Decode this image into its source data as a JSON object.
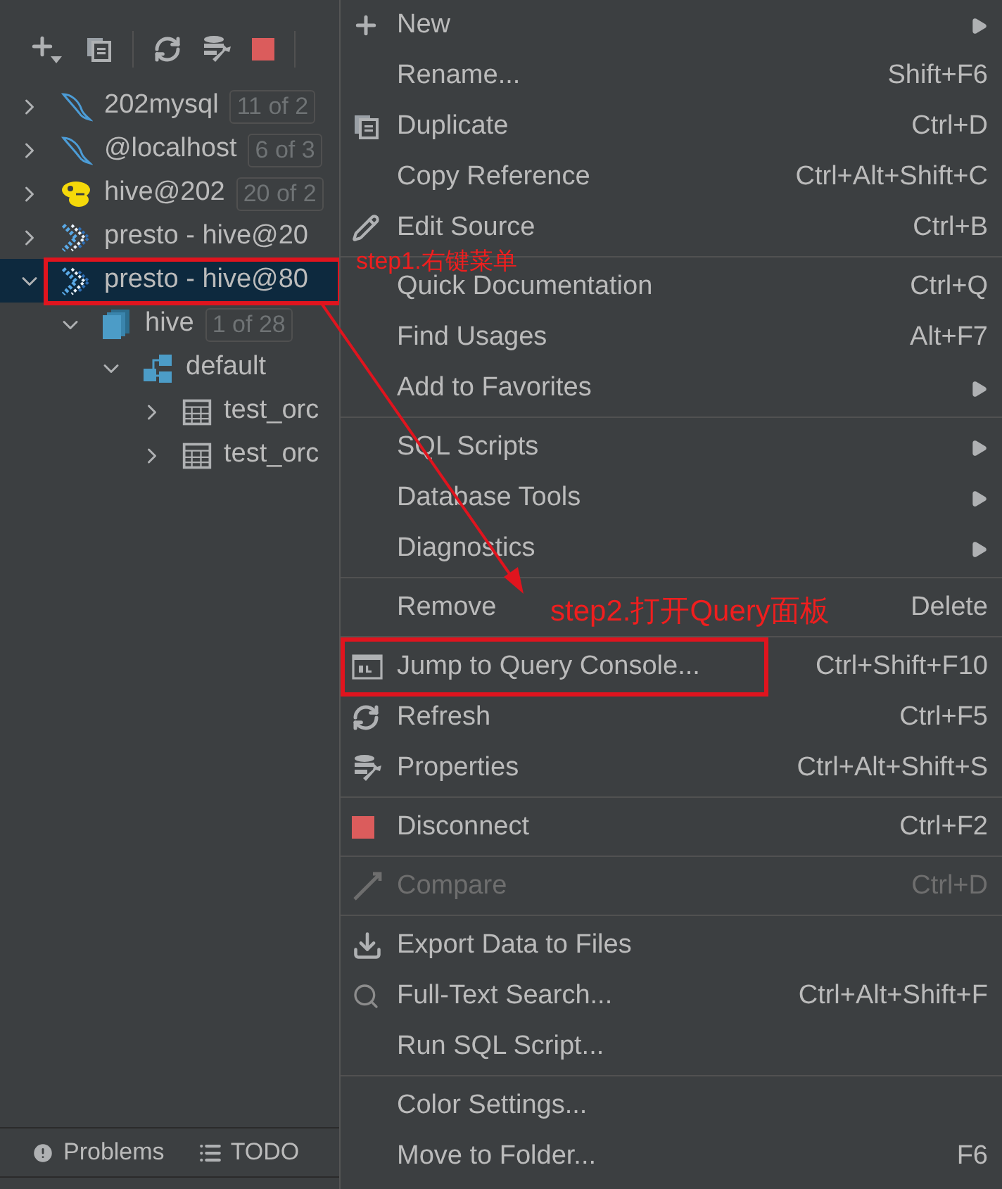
{
  "toolbar": [
    {
      "kind": "add"
    },
    {
      "kind": "duplicate"
    },
    {
      "kind": "refresh"
    },
    {
      "kind": "properties"
    },
    {
      "kind": "stop"
    }
  ],
  "tree": [
    {
      "label": "202mysql",
      "kind": "mysql",
      "badge": "11 of 2",
      "expanded": false,
      "selected": false
    },
    {
      "label": "@localhost",
      "kind": "mysql",
      "badge": "6 of 3",
      "expanded": false,
      "selected": false
    },
    {
      "label": "hive@202",
      "kind": "hive",
      "badge": "20 of 2",
      "expanded": false,
      "selected": false
    },
    {
      "label": "presto - hive@20",
      "kind": "presto",
      "expanded": false,
      "selected": false
    },
    {
      "label": "presto - hive@80",
      "kind": "presto",
      "expanded": true,
      "selected": true,
      "annotated": true,
      "children": [
        {
          "label": "hive",
          "kind": "database",
          "badge": "1 of 28",
          "expanded": true,
          "selected": false,
          "children": [
            {
              "label": "default",
              "kind": "schema",
              "expanded": true,
              "selected": false,
              "children": [
                {
                  "label": "test_orc",
                  "kind": "table",
                  "expanded": false,
                  "selected": false
                },
                {
                  "label": "test_orc",
                  "kind": "table",
                  "expanded": false,
                  "selected": false
                }
              ]
            }
          ]
        }
      ]
    }
  ],
  "tool_windows": [
    {
      "label": "Problems",
      "kind": "problems"
    },
    {
      "label": "TODO",
      "kind": "todo"
    }
  ],
  "menu": [
    [
      {
        "label": "New",
        "kind": "plus",
        "submenu": true,
        "disabled": false
      },
      {
        "label": "Rename...",
        "shortcut": "Shift+F6",
        "disabled": false
      },
      {
        "label": "Duplicate",
        "kind": "duplicate",
        "shortcut": "Ctrl+D",
        "disabled": false
      },
      {
        "label": "Copy Reference",
        "shortcut": "Ctrl+Alt+Shift+C",
        "disabled": false
      },
      {
        "label": "Edit Source",
        "kind": "pencil",
        "shortcut": "Ctrl+B",
        "disabled": false
      }
    ],
    [
      {
        "label": "Quick Documentation",
        "shortcut": "Ctrl+Q",
        "disabled": false
      },
      {
        "label": "Find Usages",
        "shortcut": "Alt+F7",
        "disabled": false
      },
      {
        "label": "Add to Favorites",
        "submenu": true,
        "disabled": false
      }
    ],
    [
      {
        "label": "SQL Scripts",
        "submenu": true,
        "disabled": false
      },
      {
        "label": "Database Tools",
        "submenu": true,
        "disabled": false
      },
      {
        "label": "Diagnostics",
        "submenu": true,
        "disabled": false
      }
    ],
    [
      {
        "label": "Remove",
        "shortcut": "Delete",
        "disabled": false
      }
    ],
    [
      {
        "label": "Jump to Query Console...",
        "kind": "console",
        "shortcut": "Ctrl+Shift+F10",
        "disabled": false,
        "annotated": true
      },
      {
        "label": "Refresh",
        "kind": "refresh",
        "shortcut": "Ctrl+F5",
        "disabled": false
      },
      {
        "label": "Properties",
        "kind": "properties",
        "shortcut": "Ctrl+Alt+Shift+S",
        "disabled": false
      }
    ],
    [
      {
        "label": "Disconnect",
        "kind": "stop",
        "shortcut": "Ctrl+F2",
        "disabled": false
      }
    ],
    [
      {
        "label": "Compare",
        "kind": "compare",
        "shortcut": "Ctrl+D",
        "disabled": true
      }
    ],
    [
      {
        "label": "Export Data to Files",
        "kind": "download",
        "disabled": false
      },
      {
        "label": "Full-Text Search...",
        "kind": "search",
        "shortcut": "Ctrl+Alt+Shift+F",
        "disabled": false
      },
      {
        "label": "Run SQL Script...",
        "disabled": false
      }
    ],
    [
      {
        "label": "Color Settings...",
        "disabled": false
      },
      {
        "label": "Move to Folder...",
        "shortcut": "F6",
        "disabled": false
      }
    ]
  ],
  "annotations": {
    "step1": "step1.右键菜单",
    "step2": "step2.打开Query面板"
  }
}
